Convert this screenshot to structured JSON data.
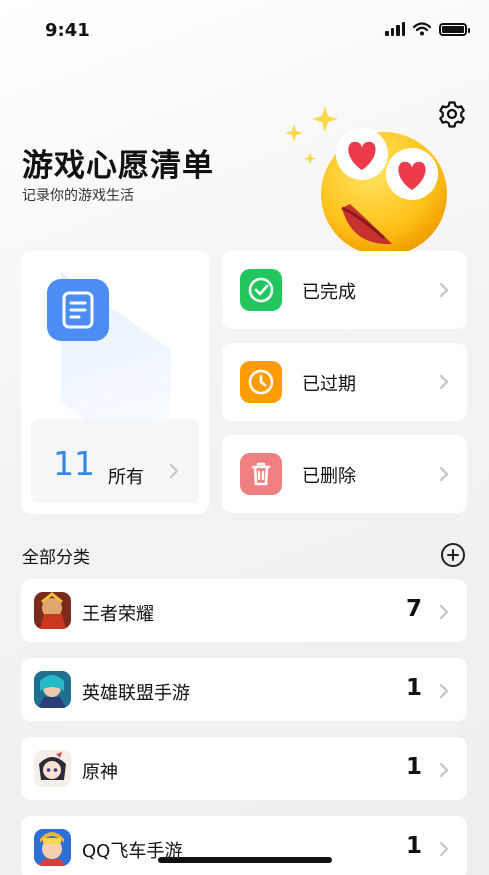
{
  "status_bar": {
    "time": "9:41"
  },
  "header": {
    "title": "游戏心愿清单",
    "subtitle": "记录你的游戏生活"
  },
  "summary": {
    "all": {
      "count": "11",
      "label": "所有"
    },
    "completed": {
      "label": "已完成",
      "color": "#22c55e"
    },
    "expired": {
      "label": "已过期",
      "color": "#ff9d00"
    },
    "deleted": {
      "label": "已删除",
      "color": "#f07f7f"
    },
    "all_icon_color": "#4b8df5"
  },
  "categories": {
    "title": "全部分类",
    "items": [
      {
        "name": "王者荣耀",
        "count": "7",
        "icon": "honor-of-kings-game-icon"
      },
      {
        "name": "英雄联盟手游",
        "count": "1",
        "icon": "league-of-legends-game-icon"
      },
      {
        "name": "原神",
        "count": "1",
        "icon": "genshin-game-icon"
      },
      {
        "name": "QQ飞车手游",
        "count": "1",
        "icon": "qq-speed-game-icon"
      }
    ]
  }
}
